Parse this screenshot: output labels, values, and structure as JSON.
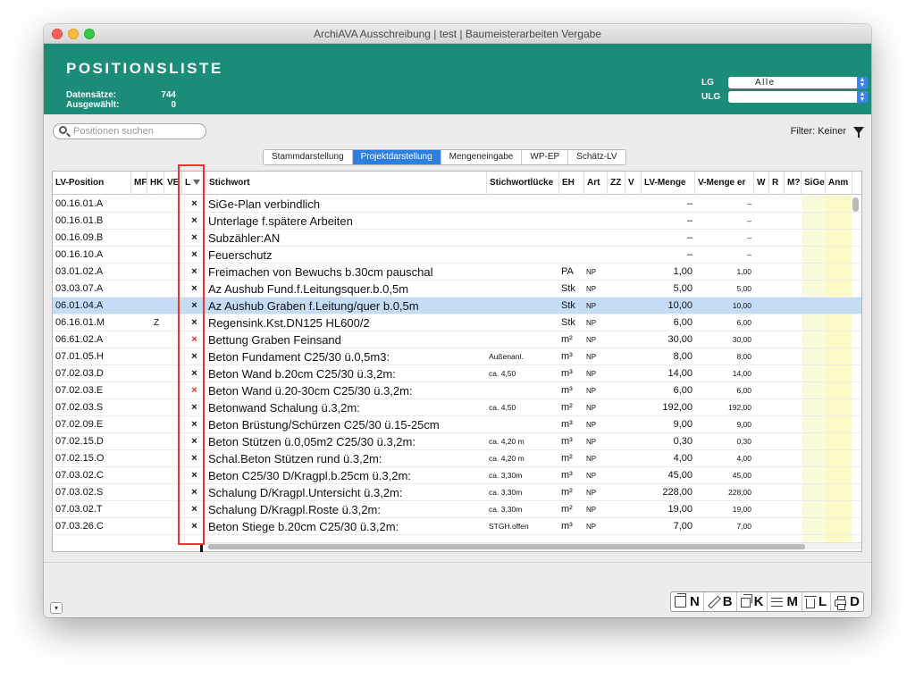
{
  "window": {
    "title": "ArchiAVA Ausschreibung | test | Baumeisterarbeiten Vergabe"
  },
  "header": {
    "title": "POSITIONSLISTE",
    "datensaetze_label": "Datensätze:",
    "datensaetze_value": "744",
    "ausgewaehlt_label": "Ausgewählt:",
    "ausgewaehlt_value": "0",
    "lg_label": "LG",
    "lg_value": "Alle",
    "ulg_label": "ULG",
    "ulg_value": ""
  },
  "search": {
    "placeholder": "Positionen suchen"
  },
  "filter": {
    "label": "Filter: Keiner"
  },
  "tabs": [
    "Stammdarstellung",
    "Projektdarstellung",
    "Mengeneingabe",
    "WP-EP",
    "Schätz-LV"
  ],
  "active_tab": "Projektdarstellung",
  "columns": {
    "lv_position": "LV-Position",
    "mf": "MF",
    "hk": "HK",
    "ve": "VE",
    "l": "L",
    "stichwort": "Stichwort",
    "stichwortluecke": "Stichwortlücke",
    "eh": "EH",
    "art": "Art",
    "zz": "ZZ",
    "v": "V",
    "lv_menge": "LV-Menge",
    "v_menge": "V-Menge er",
    "w": "W",
    "r": "R",
    "m": "M?",
    "sige": "SiGe",
    "anm": "Anm"
  },
  "rows": [
    {
      "pos": "00.16.01.A",
      "mf": "",
      "hk": "",
      "ve": "",
      "l": "×",
      "lred": false,
      "stw": "SiGe-Plan verbindlich",
      "lue": "",
      "eh": "",
      "art": "",
      "lvm": "–",
      "vm": "–",
      "sel": false
    },
    {
      "pos": "00.16.01.B",
      "mf": "",
      "hk": "",
      "ve": "",
      "l": "×",
      "lred": false,
      "stw": "Unterlage f.spätere Arbeiten",
      "lue": "",
      "eh": "",
      "art": "",
      "lvm": "–",
      "vm": "–",
      "sel": false
    },
    {
      "pos": "00.16.09.B",
      "mf": "",
      "hk": "",
      "ve": "",
      "l": "×",
      "lred": false,
      "stw": "Subzähler:AN",
      "lue": "",
      "eh": "",
      "art": "",
      "lvm": "–",
      "vm": "–",
      "sel": false
    },
    {
      "pos": "00.16.10.A",
      "mf": "",
      "hk": "",
      "ve": "",
      "l": "×",
      "lred": false,
      "stw": "Feuerschutz",
      "lue": "",
      "eh": "",
      "art": "",
      "lvm": "–",
      "vm": "–",
      "sel": false
    },
    {
      "pos": "03.01.02.A",
      "mf": "",
      "hk": "",
      "ve": "",
      "l": "×",
      "lred": false,
      "stw": "Freimachen von Bewuchs b.30cm pauschal",
      "lue": "",
      "eh": "PA",
      "art": "NP",
      "lvm": "1,00",
      "vm": "1,00",
      "sel": false
    },
    {
      "pos": "03.03.07.A",
      "mf": "",
      "hk": "",
      "ve": "",
      "l": "×",
      "lred": false,
      "stw": "Az Aushub Fund.f.Leitungsquer.b.0,5m",
      "lue": "",
      "eh": "Stk",
      "art": "NP",
      "lvm": "5,00",
      "vm": "5,00",
      "sel": false
    },
    {
      "pos": "06.01.04.A",
      "mf": "",
      "hk": "",
      "ve": "",
      "l": "×",
      "lred": false,
      "stw": "Az Aushub Graben f.Leitung/quer b.0,5m",
      "lue": "",
      "eh": "Stk",
      "art": "NP",
      "lvm": "10,00",
      "vm": "10,00",
      "sel": true
    },
    {
      "pos": "06.16.01.M",
      "mf": "",
      "hk": "Z",
      "ve": "",
      "l": "×",
      "lred": false,
      "stw": "Regensink.Kst.DN125 HL600/2",
      "lue": "",
      "eh": "Stk",
      "art": "NP",
      "lvm": "6,00",
      "vm": "6,00",
      "sel": false
    },
    {
      "pos": "06.61.02.A",
      "mf": "",
      "hk": "",
      "ve": "",
      "l": "×",
      "lred": true,
      "stw": "Bettung Graben Feinsand",
      "lue": "",
      "eh": "m²",
      "art": "NP",
      "lvm": "30,00",
      "vm": "30,00",
      "sel": false
    },
    {
      "pos": "07.01.05.H",
      "mf": "",
      "hk": "",
      "ve": "",
      "l": "×",
      "lred": false,
      "stw": "Beton Fundament C25/30 ü.0,5m3:",
      "lue": "Außenanl.",
      "eh": "m³",
      "art": "NP",
      "lvm": "8,00",
      "vm": "8,00",
      "sel": false
    },
    {
      "pos": "07.02.03.D",
      "mf": "",
      "hk": "",
      "ve": "",
      "l": "×",
      "lred": false,
      "stw": "Beton Wand b.20cm C25/30 ü.3,2m:",
      "lue": "ca. 4,50",
      "eh": "m³",
      "art": "NP",
      "lvm": "14,00",
      "vm": "14,00",
      "sel": false
    },
    {
      "pos": "07.02.03.E",
      "mf": "",
      "hk": "",
      "ve": "",
      "l": "×",
      "lred": true,
      "stw": "Beton Wand ü.20-30cm C25/30 ü.3,2m:",
      "lue": "",
      "eh": "m³",
      "art": "NP",
      "lvm": "6,00",
      "vm": "6,00",
      "sel": false
    },
    {
      "pos": "07.02.03.S",
      "mf": "",
      "hk": "",
      "ve": "",
      "l": "×",
      "lred": false,
      "stw": "Betonwand Schalung ü.3,2m:",
      "lue": "ca. 4,50",
      "eh": "m²",
      "art": "NP",
      "lvm": "192,00",
      "vm": "192,00",
      "sel": false
    },
    {
      "pos": "07.02.09.E",
      "mf": "",
      "hk": "",
      "ve": "",
      "l": "×",
      "lred": false,
      "stw": "Beton Brüstung/Schürzen C25/30 ü.15-25cm",
      "lue": "",
      "eh": "m³",
      "art": "NP",
      "lvm": "9,00",
      "vm": "9,00",
      "sel": false
    },
    {
      "pos": "07.02.15.D",
      "mf": "",
      "hk": "",
      "ve": "",
      "l": "×",
      "lred": false,
      "stw": "Beton Stützen ü.0,05m2 C25/30 ü.3,2m:",
      "lue": "ca. 4,20 m",
      "eh": "m³",
      "art": "NP",
      "lvm": "0,30",
      "vm": "0,30",
      "sel": false
    },
    {
      "pos": "07.02.15.O",
      "mf": "",
      "hk": "",
      "ve": "",
      "l": "×",
      "lred": false,
      "stw": "Schal.Beton Stützen rund ü.3,2m:",
      "lue": "ca. 4,20 m",
      "eh": "m²",
      "art": "NP",
      "lvm": "4,00",
      "vm": "4,00",
      "sel": false
    },
    {
      "pos": "07.03.02.C",
      "mf": "",
      "hk": "",
      "ve": "",
      "l": "×",
      "lred": false,
      "stw": "Beton C25/30 D/Kragpl.b.25cm ü.3,2m:",
      "lue": "ca. 3,30m",
      "eh": "m³",
      "art": "NP",
      "lvm": "45,00",
      "vm": "45,00",
      "sel": false
    },
    {
      "pos": "07.03.02.S",
      "mf": "",
      "hk": "",
      "ve": "",
      "l": "×",
      "lred": false,
      "stw": "Schalung D/Kragpl.Untersicht ü.3,2m:",
      "lue": "ca. 3,30m",
      "eh": "m²",
      "art": "NP",
      "lvm": "228,00",
      "vm": "228,00",
      "sel": false
    },
    {
      "pos": "07.03.02.T",
      "mf": "",
      "hk": "",
      "ve": "",
      "l": "×",
      "lred": false,
      "stw": "Schalung D/Kragpl.Roste ü.3,2m:",
      "lue": "ca. 3,30m",
      "eh": "m²",
      "art": "NP",
      "lvm": "19,00",
      "vm": "19,00",
      "sel": false
    },
    {
      "pos": "07.03.26.C",
      "mf": "",
      "hk": "",
      "ve": "",
      "l": "×",
      "lred": false,
      "stw": "Beton Stiege b.20cm C25/30 ü.3,2m:",
      "lue": "STGH.offen",
      "eh": "m³",
      "art": "NP",
      "lvm": "7,00",
      "vm": "7,00",
      "sel": false
    }
  ],
  "toolbar": {
    "new_key": "N",
    "edit_key": "B",
    "copy_key": "K",
    "menu_key": "M",
    "delete_key": "L",
    "print_key": "D"
  },
  "icons": {
    "collapse": "chevron-down-icon"
  },
  "colors": {
    "header_bg": "#1a8c78",
    "selected_row": "#c5dcf7",
    "highlight": "#e5392e",
    "active_tab": "#2f7fe0"
  }
}
